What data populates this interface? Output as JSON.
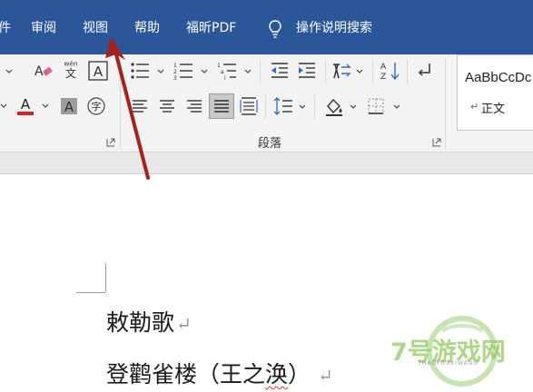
{
  "menu": {
    "items": [
      "件",
      "审阅",
      "视图",
      "帮助",
      "福昕PDF"
    ],
    "search_label": "操作说明搜索"
  },
  "ribbon": {
    "paragraph_group_label": "段落",
    "styles": {
      "sample": "AaBbCcDc",
      "name": "正文",
      "mark": "↵"
    },
    "pinyin_glyph": "wén",
    "pinyin_base": "文",
    "char_border_glyph": "A",
    "font_color_glyph": "A",
    "shading_glyph": "A",
    "enclose_glyph": "字",
    "colors": {
      "font_color_bar": "#e02020",
      "highlight": "#9c9c9c"
    }
  },
  "document": {
    "lines": [
      {
        "text": "敕勒歌",
        "mark": "↵"
      },
      {
        "text_before": "登鹳雀楼（王之",
        "text_squiggle": "涣",
        "text_after": "）",
        "mark": "↵"
      }
    ]
  },
  "watermark": {
    "text": "7号游戏网",
    "sub": "7HAOYOUXIWANG"
  },
  "annotation": {
    "arrow_color": "#a6201c"
  },
  "colors": {
    "menubar": "#2b579a",
    "ribbon": "#f3f3f3"
  }
}
